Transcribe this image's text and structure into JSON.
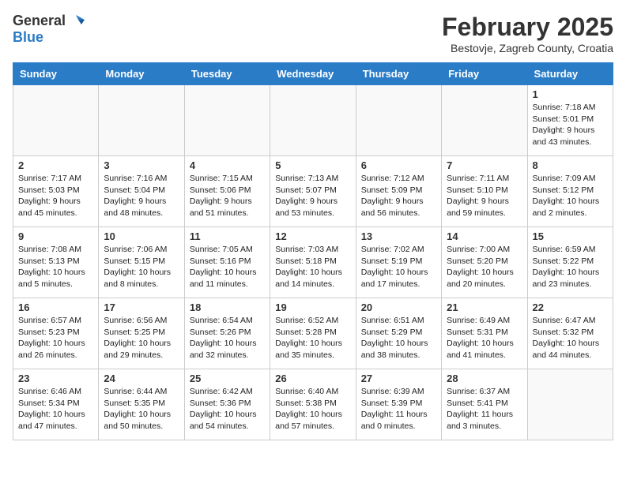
{
  "header": {
    "logo_general": "General",
    "logo_blue": "Blue",
    "title": "February 2025",
    "subtitle": "Bestovje, Zagreb County, Croatia"
  },
  "days_of_week": [
    "Sunday",
    "Monday",
    "Tuesday",
    "Wednesday",
    "Thursday",
    "Friday",
    "Saturday"
  ],
  "weeks": [
    [
      {
        "day": "",
        "info": ""
      },
      {
        "day": "",
        "info": ""
      },
      {
        "day": "",
        "info": ""
      },
      {
        "day": "",
        "info": ""
      },
      {
        "day": "",
        "info": ""
      },
      {
        "day": "",
        "info": ""
      },
      {
        "day": "1",
        "info": "Sunrise: 7:18 AM\nSunset: 5:01 PM\nDaylight: 9 hours and 43 minutes."
      }
    ],
    [
      {
        "day": "2",
        "info": "Sunrise: 7:17 AM\nSunset: 5:03 PM\nDaylight: 9 hours and 45 minutes."
      },
      {
        "day": "3",
        "info": "Sunrise: 7:16 AM\nSunset: 5:04 PM\nDaylight: 9 hours and 48 minutes."
      },
      {
        "day": "4",
        "info": "Sunrise: 7:15 AM\nSunset: 5:06 PM\nDaylight: 9 hours and 51 minutes."
      },
      {
        "day": "5",
        "info": "Sunrise: 7:13 AM\nSunset: 5:07 PM\nDaylight: 9 hours and 53 minutes."
      },
      {
        "day": "6",
        "info": "Sunrise: 7:12 AM\nSunset: 5:09 PM\nDaylight: 9 hours and 56 minutes."
      },
      {
        "day": "7",
        "info": "Sunrise: 7:11 AM\nSunset: 5:10 PM\nDaylight: 9 hours and 59 minutes."
      },
      {
        "day": "8",
        "info": "Sunrise: 7:09 AM\nSunset: 5:12 PM\nDaylight: 10 hours and 2 minutes."
      }
    ],
    [
      {
        "day": "9",
        "info": "Sunrise: 7:08 AM\nSunset: 5:13 PM\nDaylight: 10 hours and 5 minutes."
      },
      {
        "day": "10",
        "info": "Sunrise: 7:06 AM\nSunset: 5:15 PM\nDaylight: 10 hours and 8 minutes."
      },
      {
        "day": "11",
        "info": "Sunrise: 7:05 AM\nSunset: 5:16 PM\nDaylight: 10 hours and 11 minutes."
      },
      {
        "day": "12",
        "info": "Sunrise: 7:03 AM\nSunset: 5:18 PM\nDaylight: 10 hours and 14 minutes."
      },
      {
        "day": "13",
        "info": "Sunrise: 7:02 AM\nSunset: 5:19 PM\nDaylight: 10 hours and 17 minutes."
      },
      {
        "day": "14",
        "info": "Sunrise: 7:00 AM\nSunset: 5:20 PM\nDaylight: 10 hours and 20 minutes."
      },
      {
        "day": "15",
        "info": "Sunrise: 6:59 AM\nSunset: 5:22 PM\nDaylight: 10 hours and 23 minutes."
      }
    ],
    [
      {
        "day": "16",
        "info": "Sunrise: 6:57 AM\nSunset: 5:23 PM\nDaylight: 10 hours and 26 minutes."
      },
      {
        "day": "17",
        "info": "Sunrise: 6:56 AM\nSunset: 5:25 PM\nDaylight: 10 hours and 29 minutes."
      },
      {
        "day": "18",
        "info": "Sunrise: 6:54 AM\nSunset: 5:26 PM\nDaylight: 10 hours and 32 minutes."
      },
      {
        "day": "19",
        "info": "Sunrise: 6:52 AM\nSunset: 5:28 PM\nDaylight: 10 hours and 35 minutes."
      },
      {
        "day": "20",
        "info": "Sunrise: 6:51 AM\nSunset: 5:29 PM\nDaylight: 10 hours and 38 minutes."
      },
      {
        "day": "21",
        "info": "Sunrise: 6:49 AM\nSunset: 5:31 PM\nDaylight: 10 hours and 41 minutes."
      },
      {
        "day": "22",
        "info": "Sunrise: 6:47 AM\nSunset: 5:32 PM\nDaylight: 10 hours and 44 minutes."
      }
    ],
    [
      {
        "day": "23",
        "info": "Sunrise: 6:46 AM\nSunset: 5:34 PM\nDaylight: 10 hours and 47 minutes."
      },
      {
        "day": "24",
        "info": "Sunrise: 6:44 AM\nSunset: 5:35 PM\nDaylight: 10 hours and 50 minutes."
      },
      {
        "day": "25",
        "info": "Sunrise: 6:42 AM\nSunset: 5:36 PM\nDaylight: 10 hours and 54 minutes."
      },
      {
        "day": "26",
        "info": "Sunrise: 6:40 AM\nSunset: 5:38 PM\nDaylight: 10 hours and 57 minutes."
      },
      {
        "day": "27",
        "info": "Sunrise: 6:39 AM\nSunset: 5:39 PM\nDaylight: 11 hours and 0 minutes."
      },
      {
        "day": "28",
        "info": "Sunrise: 6:37 AM\nSunset: 5:41 PM\nDaylight: 11 hours and 3 minutes."
      },
      {
        "day": "",
        "info": ""
      }
    ]
  ]
}
